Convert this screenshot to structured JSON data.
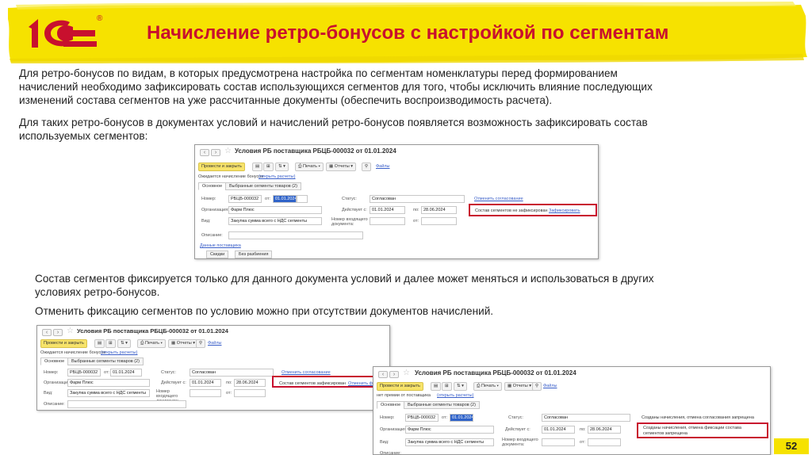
{
  "header": {
    "logo_text": "1С",
    "logo_reg": "®",
    "title": "Начисление ретро-бонусов с настройкой по сегментам"
  },
  "text": {
    "p1_line1": "Для ретро-бонусов по видам, в которых предусмотрена настройка по сегментам номенклатуры перед формированием",
    "p1_line2": "начислений необходимо зафиксировать состав использующихся сегментов для того, чтобы исключить влияние последующих",
    "p1_line3": "изменений состава сегментов на уже рассчитанные документы (обеспечить воспроизводимость расчета).",
    "p2_line1": "Для таких ретро-бонусов в документах условий и начислений ретро-бонусов появляется возможность зафиксировать состав",
    "p2_line2": "используемых сегментов:",
    "p3_line1": "Состав сегментов фиксируется только для данного документа условий и далее может меняться и использоваться в других",
    "p3_line2": "условиях ретро-бонусов.",
    "p4": "Отменить фиксацию сегментов по условию можно при отсутствии документов начислений."
  },
  "doc": {
    "title": "Условия РБ поставщика РБЦБ-000032 от 01.01.2024",
    "post_close": "Провести и закрыть",
    "print": "Печать",
    "reports": "Отчеты",
    "files": "Файлы",
    "bonus_note": "Ожидается начисление бонусов",
    "bonus_link": "(открыть расчеты)",
    "tab_main": "Основное",
    "tab_segments": "Выбранные сегменты товаров (2)",
    "label_number": "Номер:",
    "number": "РБЦБ-000032",
    "label_from": "от:",
    "date": "01.01.2024",
    "label_status": "Статус:",
    "status": "Согласован",
    "cancel_approval": "Отменить согласование",
    "label_org": "Организация:",
    "org": "Фарм Плюс",
    "label_valid": "Действует с:",
    "valid_from": "01.01.2024",
    "label_to": "по:",
    "valid_to": "28.06.2024",
    "segments_not_fixed": "Состав сегментов не зафиксирован",
    "fix_link": "Зафиксировать",
    "segments_fixed": "Состав сегментов зафиксирован",
    "cancel_fix": "Отменить фиксацию",
    "label_kind": "Вид:",
    "kind": "Закупка сумма всего с НДС сегменты",
    "label_incoming": "Номер входящего документа:",
    "label_of": "от:",
    "label_desc": "Описание:",
    "supplier_data": "Данные поставщика",
    "btn_discounts": "Скидки",
    "btn_nobreak": "Без разбиения",
    "accruals_created": "Созданы начисления, отмена согласования запрещена",
    "fix_cancel_forbidden": "Созданы начисления, отмена фиксации состава сегментов запрещена",
    "bonus_note3": "нет премии от поставщика",
    "bonus_link3": "(открыть расчеты)"
  },
  "page_number": "52",
  "colors": {
    "brand_red": "#c8102e",
    "banner_yellow": "#f6e200",
    "link_blue": "#3a5fc9"
  }
}
